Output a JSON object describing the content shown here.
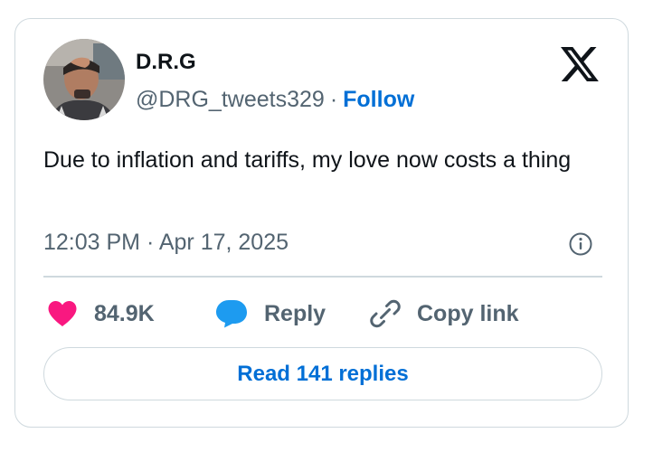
{
  "author": {
    "display_name": "D.R.G",
    "handle": "@DRG_tweets329",
    "separator": "·",
    "follow_label": "Follow"
  },
  "tweet": {
    "text": "Due to inflation and tariffs, my love now costs a thing",
    "timestamp": "12:03 PM · Apr 17, 2025"
  },
  "actions": {
    "like_count": "84.9K",
    "reply_label": "Reply",
    "copy_link_label": "Copy link"
  },
  "read_replies_label": "Read 141 replies",
  "icons": {
    "brand": "x-logo-icon",
    "info": "info-icon",
    "like": "heart-icon",
    "reply": "speech-bubble-icon",
    "copy": "link-icon"
  },
  "colors": {
    "link_blue": "#006fd6",
    "like_pink": "#f91880",
    "reply_blue": "#1d9bf0",
    "muted_text": "#536471",
    "border": "#cfd9de"
  }
}
